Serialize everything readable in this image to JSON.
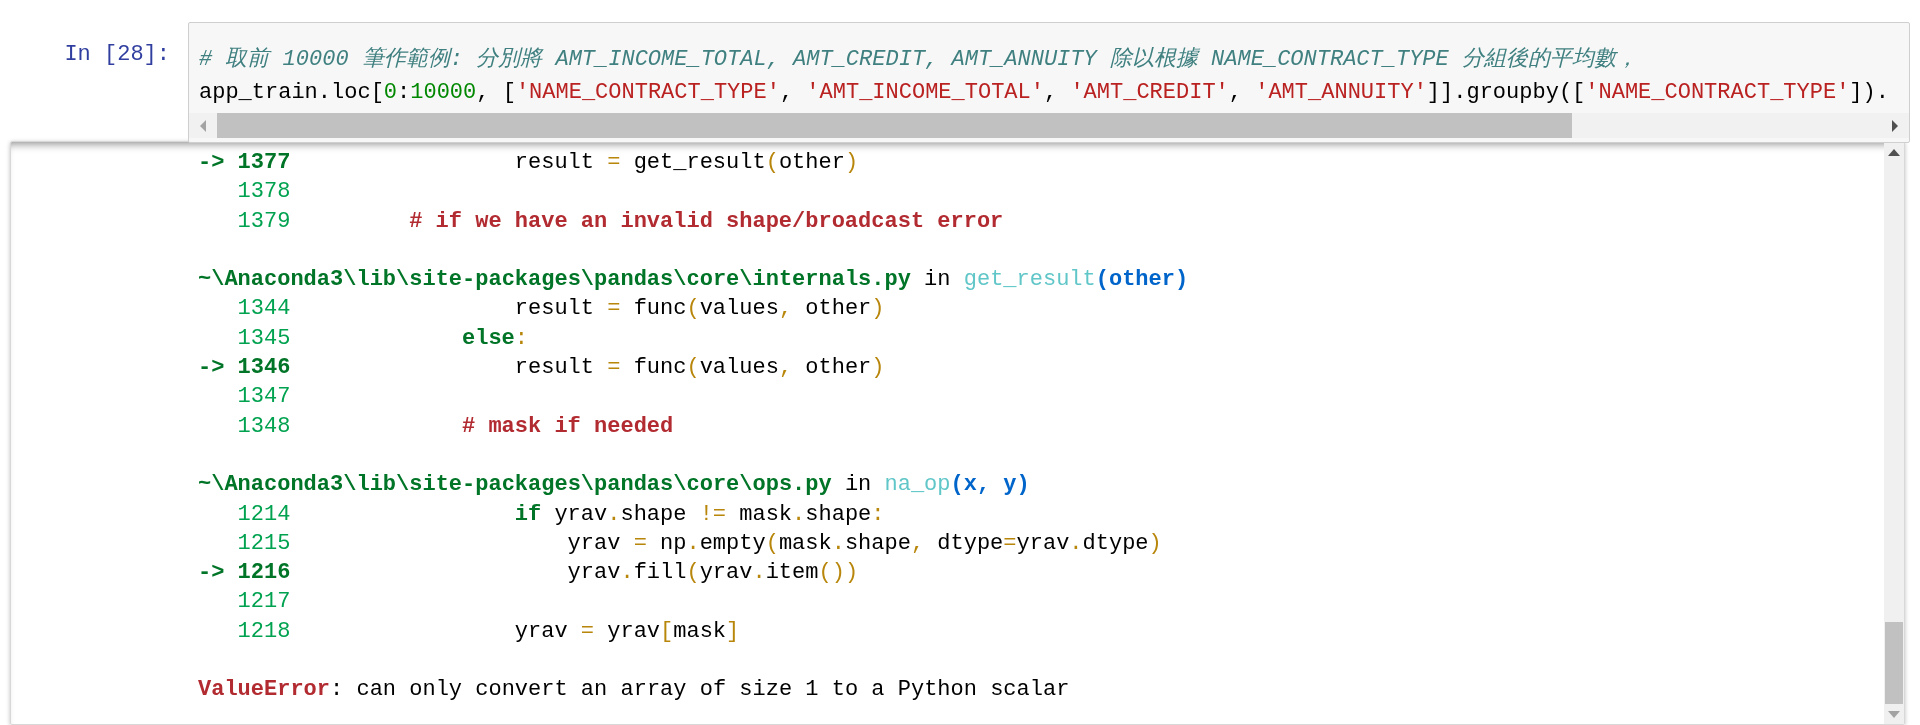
{
  "prompt": "In [28]:",
  "input": {
    "lines": [
      [
        {
          "kind": "comment",
          "text": "# 取前 10000 筆作範例: 分別將 AMT_INCOME_TOTAL, AMT_CREDIT, AMT_ANNUITY 除以根據 NAME_CONTRACT_TYPE 分組後的平均數，"
        }
      ],
      [
        {
          "kind": "plain",
          "text": "app_train.loc["
        },
        {
          "kind": "number",
          "text": "0"
        },
        {
          "kind": "plain",
          "text": ":"
        },
        {
          "kind": "number",
          "text": "10000"
        },
        {
          "kind": "plain",
          "text": ", ["
        },
        {
          "kind": "string",
          "text": "'NAME_CONTRACT_TYPE'"
        },
        {
          "kind": "plain",
          "text": ", "
        },
        {
          "kind": "string",
          "text": "'AMT_INCOME_TOTAL'"
        },
        {
          "kind": "plain",
          "text": ", "
        },
        {
          "kind": "string",
          "text": "'AMT_CREDIT'"
        },
        {
          "kind": "plain",
          "text": ", "
        },
        {
          "kind": "string",
          "text": "'AMT_ANNUITY'"
        },
        {
          "kind": "plain",
          "text": "]].groupby(["
        },
        {
          "kind": "string",
          "text": "'NAME_CONTRACT_TYPE'"
        },
        {
          "kind": "plain",
          "text": "])."
        }
      ]
    ]
  },
  "output": {
    "rows": [
      {
        "kind": "line",
        "current": true,
        "arrow": "->",
        "number": "1377",
        "code": [
          {
            "kind": "plain",
            "text": "                result "
          },
          {
            "kind": "op",
            "text": "="
          },
          {
            "kind": "plain",
            "text": " get_result"
          },
          {
            "kind": "op",
            "text": "("
          },
          {
            "kind": "plain",
            "text": "other"
          },
          {
            "kind": "op",
            "text": ")"
          }
        ]
      },
      {
        "kind": "line",
        "current": false,
        "number": "1378",
        "code": []
      },
      {
        "kind": "line",
        "current": false,
        "number": "1379",
        "code": [
          {
            "kind": "tbcomment",
            "text": "        # if we have an invalid shape/broadcast error"
          }
        ]
      },
      {
        "kind": "blank"
      },
      {
        "kind": "header",
        "code": [
          {
            "kind": "path",
            "text": "~\\Anaconda3\\lib\\site-packages\\pandas\\core\\internals.py"
          },
          {
            "kind": "plain",
            "text": " in "
          },
          {
            "kind": "func",
            "text": "get_result"
          },
          {
            "kind": "args",
            "text": "(other)"
          }
        ]
      },
      {
        "kind": "line",
        "current": false,
        "number": "1344",
        "code": [
          {
            "kind": "plain",
            "text": "                result "
          },
          {
            "kind": "op",
            "text": "="
          },
          {
            "kind": "plain",
            "text": " func"
          },
          {
            "kind": "op",
            "text": "("
          },
          {
            "kind": "plain",
            "text": "values"
          },
          {
            "kind": "op",
            "text": ","
          },
          {
            "kind": "plain",
            "text": " other"
          },
          {
            "kind": "op",
            "text": ")"
          }
        ]
      },
      {
        "kind": "line",
        "current": false,
        "number": "1345",
        "code": [
          {
            "kind": "keyword",
            "text": "            else"
          },
          {
            "kind": "op",
            "text": ":"
          }
        ]
      },
      {
        "kind": "line",
        "current": true,
        "arrow": "->",
        "number": "1346",
        "code": [
          {
            "kind": "plain",
            "text": "                result "
          },
          {
            "kind": "op",
            "text": "="
          },
          {
            "kind": "plain",
            "text": " func"
          },
          {
            "kind": "op",
            "text": "("
          },
          {
            "kind": "plain",
            "text": "values"
          },
          {
            "kind": "op",
            "text": ","
          },
          {
            "kind": "plain",
            "text": " other"
          },
          {
            "kind": "op",
            "text": ")"
          }
        ]
      },
      {
        "kind": "line",
        "current": false,
        "number": "1347",
        "code": []
      },
      {
        "kind": "line",
        "current": false,
        "number": "1348",
        "code": [
          {
            "kind": "tbcomment",
            "text": "            # mask if needed"
          }
        ]
      },
      {
        "kind": "blank"
      },
      {
        "kind": "header",
        "code": [
          {
            "kind": "path",
            "text": "~\\Anaconda3\\lib\\site-packages\\pandas\\core\\ops.py"
          },
          {
            "kind": "plain",
            "text": " in "
          },
          {
            "kind": "func",
            "text": "na_op"
          },
          {
            "kind": "args",
            "text": "(x, y)"
          }
        ]
      },
      {
        "kind": "line",
        "current": false,
        "number": "1214",
        "code": [
          {
            "kind": "keyword",
            "text": "                if"
          },
          {
            "kind": "plain",
            "text": " yrav"
          },
          {
            "kind": "op",
            "text": "."
          },
          {
            "kind": "plain",
            "text": "shape "
          },
          {
            "kind": "op",
            "text": "!="
          },
          {
            "kind": "plain",
            "text": " mask"
          },
          {
            "kind": "op",
            "text": "."
          },
          {
            "kind": "plain",
            "text": "shape"
          },
          {
            "kind": "op",
            "text": ":"
          }
        ]
      },
      {
        "kind": "line",
        "current": false,
        "number": "1215",
        "code": [
          {
            "kind": "plain",
            "text": "                    yrav "
          },
          {
            "kind": "op",
            "text": "="
          },
          {
            "kind": "plain",
            "text": " np"
          },
          {
            "kind": "op",
            "text": "."
          },
          {
            "kind": "plain",
            "text": "empty"
          },
          {
            "kind": "op",
            "text": "("
          },
          {
            "kind": "plain",
            "text": "mask"
          },
          {
            "kind": "op",
            "text": "."
          },
          {
            "kind": "plain",
            "text": "shape"
          },
          {
            "kind": "op",
            "text": ","
          },
          {
            "kind": "plain",
            "text": " dtype"
          },
          {
            "kind": "op",
            "text": "="
          },
          {
            "kind": "plain",
            "text": "yrav"
          },
          {
            "kind": "op",
            "text": "."
          },
          {
            "kind": "plain",
            "text": "dtype"
          },
          {
            "kind": "op",
            "text": ")"
          }
        ]
      },
      {
        "kind": "line",
        "current": true,
        "arrow": "->",
        "number": "1216",
        "code": [
          {
            "kind": "plain",
            "text": "                    yrav"
          },
          {
            "kind": "op",
            "text": "."
          },
          {
            "kind": "plain",
            "text": "fill"
          },
          {
            "kind": "op",
            "text": "("
          },
          {
            "kind": "plain",
            "text": "yrav"
          },
          {
            "kind": "op",
            "text": "."
          },
          {
            "kind": "plain",
            "text": "item"
          },
          {
            "kind": "op",
            "text": "())"
          }
        ]
      },
      {
        "kind": "line",
        "current": false,
        "number": "1217",
        "code": []
      },
      {
        "kind": "line",
        "current": false,
        "number": "1218",
        "code": [
          {
            "kind": "plain",
            "text": "                yrav "
          },
          {
            "kind": "op",
            "text": "="
          },
          {
            "kind": "plain",
            "text": " yrav"
          },
          {
            "kind": "op",
            "text": "["
          },
          {
            "kind": "plain",
            "text": "mask"
          },
          {
            "kind": "op",
            "text": "]"
          }
        ]
      },
      {
        "kind": "blank"
      },
      {
        "kind": "error",
        "code": [
          {
            "kind": "errname",
            "text": "ValueError"
          },
          {
            "kind": "plain",
            "text": ": can only convert an array of size 1 to a Python scalar"
          }
        ]
      }
    ]
  }
}
